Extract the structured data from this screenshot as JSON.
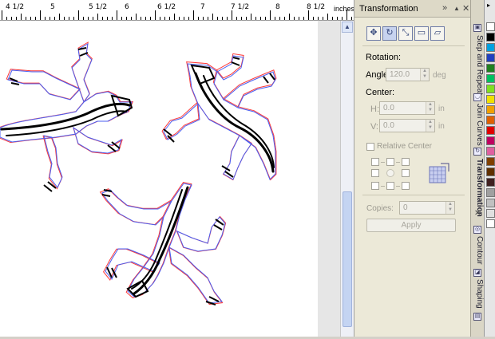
{
  "ruler": {
    "labels": [
      "4 1/2",
      "5",
      "5 1/2",
      "6",
      "6 1/2",
      "7",
      "7 1/2",
      "8",
      "8 1/2"
    ],
    "units": "inches"
  },
  "docker": {
    "title": "Transformation",
    "modes": [
      "position-icon",
      "rotate-icon",
      "scale-icon",
      "size-icon",
      "skew-icon"
    ],
    "rotation_heading": "Rotation:",
    "angle_label": "Angle:",
    "angle_value": "120.0",
    "angle_unit": "deg",
    "center_heading": "Center:",
    "h_label": "H:",
    "h_value": "0.0",
    "v_label": "V:",
    "v_value": "0.0",
    "position_unit": "in",
    "relative_center_label": "Relative Center",
    "copies_label": "Copies:",
    "copies_value": "0",
    "apply_label": "Apply"
  },
  "tabs": [
    "Step and Repeat",
    "Join Curves",
    "Transformation",
    "Contour",
    "Shaping"
  ],
  "palette_colors": [
    "#ffffff",
    "#000000",
    "#00a0e0",
    "#2040c0",
    "#208020",
    "#00c060",
    "#80e020",
    "#f0e000",
    "#f0a000",
    "#e06000",
    "#e00000",
    "#c00060",
    "#e060a0",
    "#804000",
    "#603000",
    "#402020",
    "#a0a0a0",
    "#c0c0c0",
    "#e0e0e0",
    "#ffffff"
  ]
}
